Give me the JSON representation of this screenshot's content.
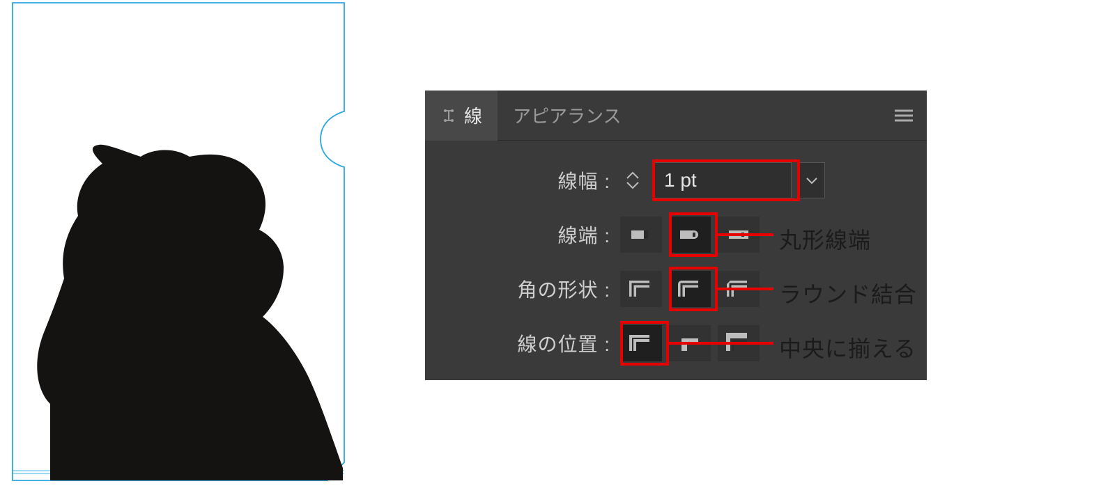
{
  "panel": {
    "tabs": {
      "stroke": "線",
      "appearance": "アピアランス"
    },
    "rows": {
      "weight": {
        "label": "線幅 :",
        "value": "1 pt"
      },
      "cap": {
        "label": "線端 :",
        "annotation": "丸形線端"
      },
      "corner": {
        "label": "角の形状 :",
        "annotation": "ラウンド結合"
      },
      "align": {
        "label": "線の位置 :",
        "annotation": "中央に揃える"
      }
    }
  }
}
